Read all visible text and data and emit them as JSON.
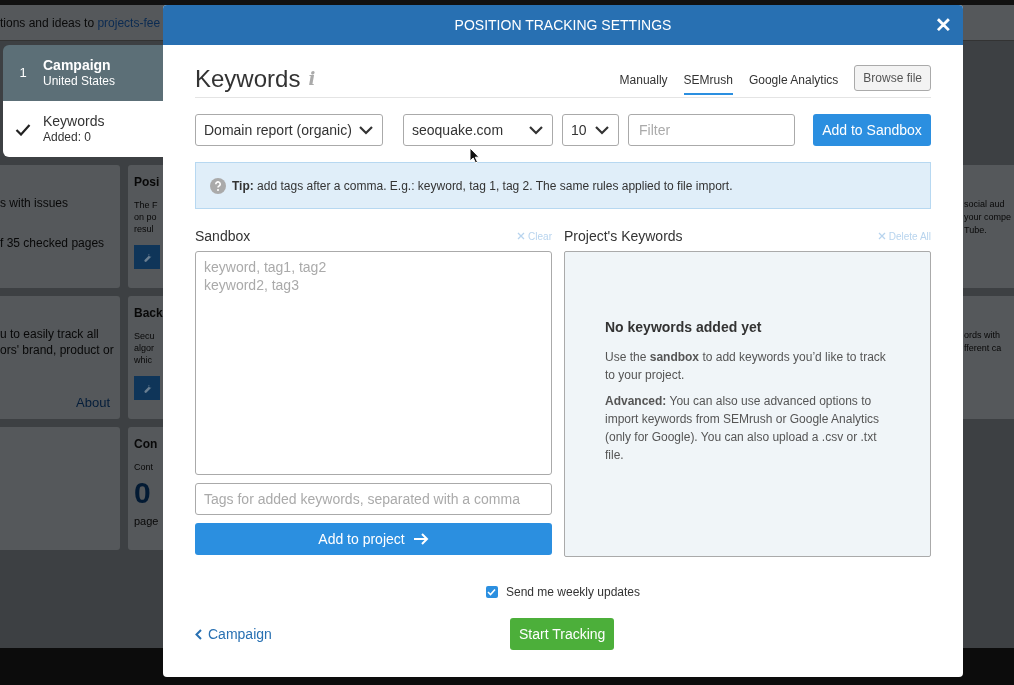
{
  "background_page": {
    "header_text": "tions and ideas to ",
    "header_link": "projects-fee",
    "left_cards": [
      {
        "lines": [
          "s with issues",
          "f 35 checked pages"
        ]
      },
      {
        "lines": [
          "u to easily track all",
          "ors' brand, product or"
        ],
        "link": "About"
      }
    ],
    "middle_cards": [
      {
        "title": "Posi",
        "lines": [
          "The F",
          "on po",
          "resul"
        ],
        "tool_button": true
      },
      {
        "title": "Back",
        "lines": [
          "Secu",
          "algor",
          "whic"
        ],
        "tool_button": true
      },
      {
        "title": "Con",
        "lines": [
          "Cont"
        ],
        "big_number": "0",
        "footer": "page"
      }
    ],
    "right_cards": [
      {
        "lines": [
          "social aud",
          "your compe",
          "Tube."
        ]
      },
      {
        "lines": [
          "ords with",
          "fferent ca"
        ]
      }
    ]
  },
  "steps": [
    {
      "kind": "number",
      "number": "1",
      "title": "Campaign",
      "subtitle": "United States",
      "selected": false
    },
    {
      "kind": "check",
      "title": "Keywords",
      "subtitle": "Added: 0",
      "selected": true
    }
  ],
  "modal": {
    "title": "POSITION TRACKING SETTINGS",
    "close": "✕",
    "heading": "Keywords",
    "info_icon": "i",
    "tabs": [
      {
        "label": "Manually",
        "selected": false
      },
      {
        "label": "SEMrush",
        "selected": true
      },
      {
        "label": "Google Analytics",
        "selected": false
      }
    ],
    "browse_button": "Browse file",
    "selects": [
      {
        "value": "Domain report (organic)"
      },
      {
        "value": "seoquake.com"
      },
      {
        "value": "10"
      }
    ],
    "filter": {
      "placeholder": "Filter"
    },
    "add_to_sandbox": "Add to Sandbox",
    "tip": "**Tip:** add tags after a comma. E.g.: keyword, tag 1, tag 2. The same rules applied to file import.",
    "sandbox": {
      "label": "Sandbox",
      "clear": "Clear",
      "placeholder": "keyword, tag1, tag2\nkeyword2, tag3",
      "tags_placeholder": "Tags for added keywords, separated with a comma",
      "add_button": "Add to project"
    },
    "project_keywords": {
      "label": "Project's Keywords",
      "delete_all": "Delete All",
      "empty_title": "No keywords added yet",
      "paragraphs": [
        "Use the **sandbox** to add keywords you’d like to track to your project.",
        "**Advanced:** You can also use advanced options to import keywords from SEMrush or Google Analytics (only for Google). You can also upload a .csv or .txt file."
      ]
    },
    "weekly_updates": {
      "label": "Send me weekly updates",
      "checked": true
    },
    "back_link": "Campaign",
    "start_button": "Start Tracking"
  }
}
